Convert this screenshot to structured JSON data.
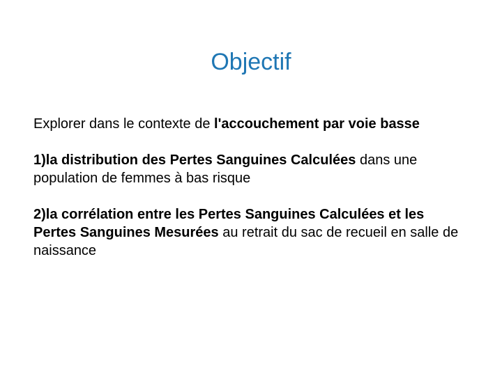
{
  "title": "Objectif",
  "intro": {
    "prefix": "Explorer dans le contexte de ",
    "bold": "l'accouchement par voie basse"
  },
  "item1": {
    "num": "1)",
    "bold": "la distribution des Pertes Sanguines Calculées",
    "rest": " dans une population de femmes à bas risque"
  },
  "item2": {
    "num": "2)",
    "bold": "la corrélation entre les Pertes Sanguines Calculées et les Pertes Sanguines Mesurées",
    "rest": " au retrait du sac de recueil en salle de naissance"
  }
}
